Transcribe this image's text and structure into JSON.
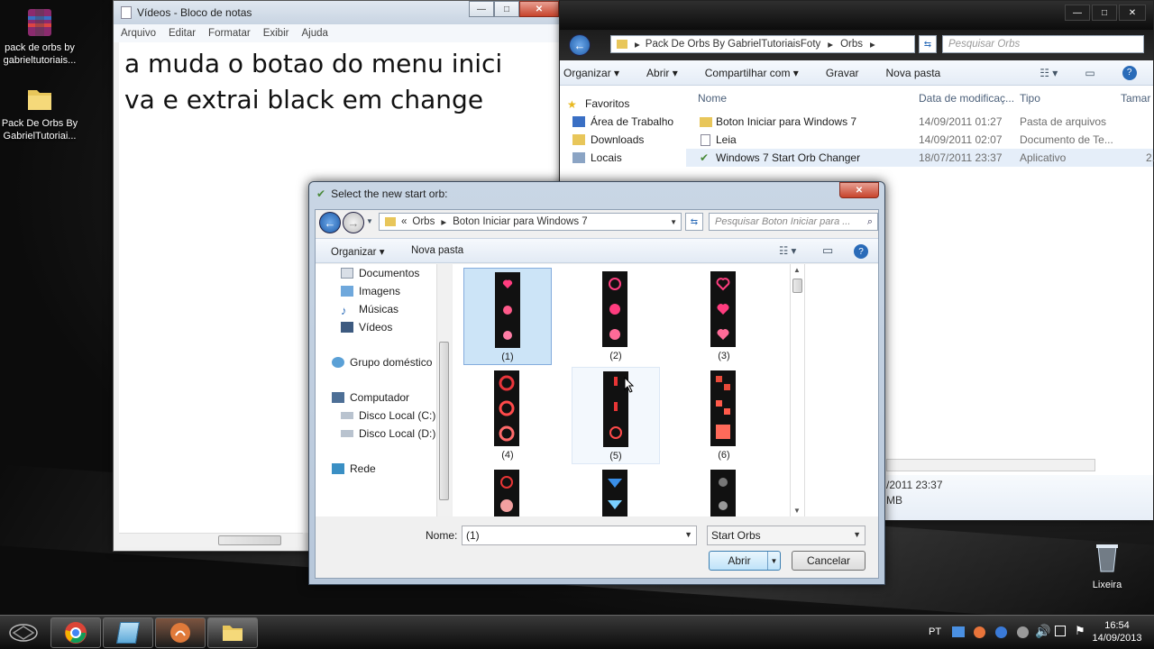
{
  "desktop": {
    "icons": [
      {
        "label": "pack de orbs by gabrieltutoriais..."
      },
      {
        "label": "Pack De Orbs By GabrielTutoriai..."
      }
    ],
    "recycle_bin": "Lixeira"
  },
  "notepad": {
    "title": "Vídeos - Bloco de notas",
    "menu": [
      "Arquivo",
      "Editar",
      "Formatar",
      "Exibir",
      "Ajuda"
    ],
    "lines": [
      "a muda o botao do menu inici",
      "va e extrai black em change"
    ],
    "caption_buttons": {
      "minimize": "—",
      "maximize": "□",
      "close": "✕"
    }
  },
  "explorer": {
    "address": [
      "Pack De Orbs By GabrielTutoriaisFoty",
      "Orbs"
    ],
    "search_placeholder": "Pesquisar Orbs",
    "toolbar": [
      "Organizar",
      "Abrir",
      "Compartilhar com",
      "Gravar",
      "Nova pasta"
    ],
    "favorites_header": "Favoritos",
    "favorites": [
      "Área de Trabalho",
      "Downloads",
      "Locais"
    ],
    "columns": [
      "Nome",
      "Data de modificaç...",
      "Tipo",
      "Tamar"
    ],
    "files": [
      {
        "name": "Boton Iniciar para Windows 7",
        "date": "14/09/2011 01:27",
        "type": "Pasta de arquivos",
        "size": ""
      },
      {
        "name": "Leia",
        "date": "14/09/2011 02:07",
        "type": "Documento de Te...",
        "size": ""
      },
      {
        "name": "Windows 7 Start Orb Changer",
        "date": "18/07/2011 23:37",
        "type": "Aplicativo",
        "size": "2."
      }
    ],
    "details_date": "/2011 23:37",
    "details_size": "MB"
  },
  "dialog": {
    "title": "Select the new start orb:",
    "breadcrumb": [
      "«",
      "Orbs",
      "Boton Iniciar para Windows 7"
    ],
    "search_placeholder": "Pesquisar Boton Iniciar para ...",
    "toolbar": [
      "Organizar",
      "Nova pasta"
    ],
    "nav": {
      "libraries": [
        "Documentos",
        "Imagens",
        "Músicas",
        "Vídeos"
      ],
      "homegroup": "Grupo doméstico",
      "computer": "Computador",
      "drives": [
        "Disco Local (C:)",
        "Disco Local (D:)"
      ],
      "network": "Rede"
    },
    "thumbnails": [
      {
        "label": "(1)",
        "selected": true
      },
      {
        "label": "(2)",
        "selected": false
      },
      {
        "label": "(3)",
        "selected": false
      },
      {
        "label": "(4)",
        "selected": false
      },
      {
        "label": "(5)",
        "selected": false,
        "hover": true
      },
      {
        "label": "(6)",
        "selected": false
      },
      {
        "label": "",
        "selected": false
      },
      {
        "label": "",
        "selected": false
      },
      {
        "label": "",
        "selected": false
      }
    ],
    "file_name_label": "Nome:",
    "file_name_value": "(1)",
    "filter_value": "Start Orbs",
    "open_label": "Abrir",
    "cancel_label": "Cancelar",
    "close_glyph": "✕"
  },
  "taskbar": {
    "language": "PT",
    "time": "16:54",
    "date": "14/09/2013"
  },
  "colors": {
    "selection": "#cce4f7",
    "dialog_frame": "#b7c7da",
    "accent_pink": "#ff3d7f"
  }
}
